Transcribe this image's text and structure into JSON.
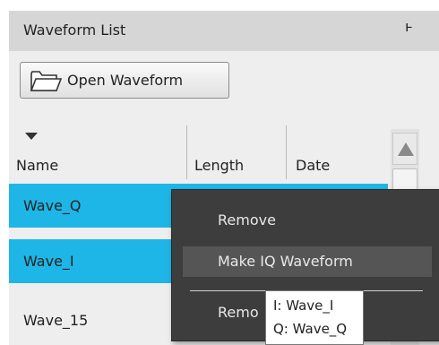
{
  "panel": {
    "title": "Waveform List",
    "pin_icon": "pin-icon"
  },
  "toolbar": {
    "open_label": "Open Waveform",
    "open_icon": "folder-icon"
  },
  "columns": [
    {
      "label": "Name"
    },
    {
      "label": "Length"
    },
    {
      "label": "Date"
    }
  ],
  "rows": [
    {
      "name": "Wave_Q",
      "selected": true
    },
    {
      "name": "Wave_I",
      "selected": true
    },
    {
      "name": "Wave_15",
      "selected": false
    }
  ],
  "context_menu": {
    "items": [
      {
        "label": "Remove"
      },
      {
        "label": "Make IQ Waveform"
      },
      {
        "label": "Remo"
      }
    ]
  },
  "tooltip": {
    "line1": "I: Wave_I",
    "line2": "Q: Wave_Q"
  },
  "colors": {
    "selection": "#1eb6e6",
    "menu_background": "#3d3d3d",
    "title_bar": "#d6d6d6"
  }
}
